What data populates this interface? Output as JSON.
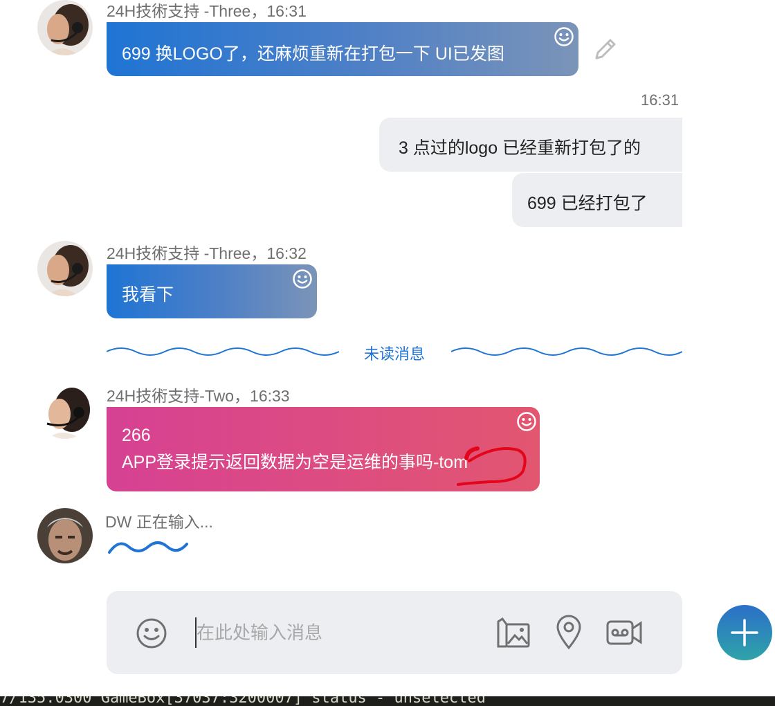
{
  "messages": [
    {
      "sender": "24H技術支持 -Three，16:31",
      "text": "699 换LOGO了，还麻烦重新在打包一下 UI已发图"
    },
    {
      "time": "16:31",
      "bubbles": [
        "3 点过的logo 已经重新打包了的",
        "699 已经打包了"
      ]
    },
    {
      "sender": "24H技術支持 -Three，16:32",
      "text": "我看下"
    },
    {
      "divider": "未读消息"
    },
    {
      "sender": "24H技術支持-Two，16:33",
      "line1": "266",
      "line2": "APP登录提示返回数据为空是运维的事吗-tom"
    },
    {
      "typing": "DW 正在输入..."
    }
  ],
  "composer": {
    "placeholder": "在此处输入消息"
  },
  "terminal": {
    "text": "7/135.0300 GameBox[37037:3200007] status - unselected"
  },
  "colors": {
    "blue_bubble_start": "#1f74d4",
    "blue_bubble_end": "#7b94b8",
    "pink_bubble_start": "#d64193",
    "pink_bubble_end": "#e25670",
    "accent": "#1f74d4",
    "outgoing_bubble": "#eceef2"
  },
  "icons": [
    "smile-icon",
    "pencil-icon",
    "emoji-icon",
    "gallery-icon",
    "location-pin-icon",
    "video-message-icon",
    "plus-icon"
  ]
}
